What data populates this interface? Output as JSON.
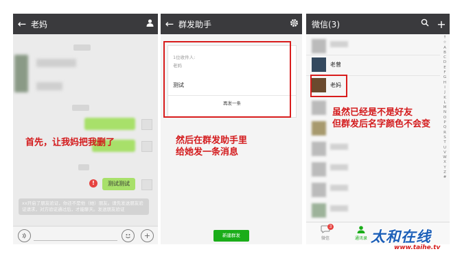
{
  "panel_chat": {
    "title": "老妈",
    "sent_message": "测试测试",
    "error_mark": "!",
    "annotation": "首先，让我妈把我删了",
    "system_notice": "xx开启了朋友验证，你还不是他（她）朋友。请先发送朋友验证请求，对方验证通过后，才能聊天。发送朋友验证",
    "voice_icon": "voice-icon",
    "emoji_icon": "emoji-icon",
    "plus_icon": "plus-icon"
  },
  "panel_broadcast": {
    "title": "群发助手",
    "recipients_label": "1位收件人:",
    "recipient_name": "老妈",
    "message_text": "测试",
    "resend_label": "再发一条",
    "annotation": "然后在群发助手里\n给她发一条消息",
    "new_broadcast_label": "新建群发",
    "settings_icon": "gear-icon"
  },
  "panel_contacts": {
    "title": "微信(3)",
    "contact_1": "老曾",
    "contact_2": "老妈",
    "annotation": "虽然已经是不是好友\n但群发后名字颜色不会变",
    "alphabet": [
      "↑",
      "☆",
      "A",
      "B",
      "C",
      "D",
      "E",
      "F",
      "G",
      "H",
      "I",
      "J",
      "K",
      "L",
      "M",
      "N",
      "O",
      "P",
      "Q",
      "R",
      "S",
      "T",
      "U",
      "V",
      "W",
      "X",
      "Y",
      "Z",
      "#"
    ],
    "tab_chats": "微信",
    "tab_contacts": "通讯录",
    "badge": "3",
    "search_icon": "search-icon"
  },
  "watermark": {
    "brand": "太和在线",
    "url": "www.taihe.tv"
  },
  "colors": {
    "header": "#3a3a3d",
    "bubble_green": "#a8e06a",
    "annotation_red": "#d3191b",
    "button_green": "#1aad19",
    "watermark_blue": "#1c5fb8"
  }
}
